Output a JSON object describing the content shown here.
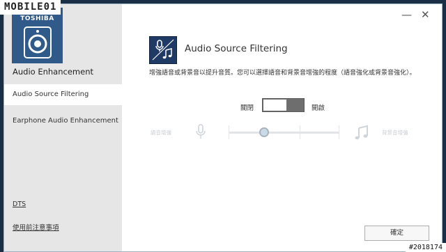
{
  "sidebar": {
    "brand": "TOSHIBA",
    "app_title": "Audio Enhancement",
    "items": [
      {
        "label": "Audio Source Filtering"
      },
      {
        "label": "Earphone Audio Enhancement"
      }
    ],
    "links": {
      "dts": "DTS",
      "notes": "使用前注意事項"
    }
  },
  "titlebar": {
    "minimize": "—",
    "close": "✕"
  },
  "main": {
    "title": "Audio Source Filtering",
    "description": "增強語音或背景音以提升音質。您可以選擇語音和背景音增強的程度（語音強化或背景音強化）。",
    "toggle": {
      "off_label": "關閉",
      "on_label": "開啟",
      "state": "off"
    },
    "slider": {
      "left_label": "語音增強",
      "right_label": "背景音增強",
      "value": 0.3
    },
    "ok_button": "確定"
  },
  "watermark": {
    "top": "MOBILE01",
    "bottom": "#2018174"
  },
  "colors": {
    "sidebar_bg": "#e6e6e6",
    "logo_bg": "#2f5a8a",
    "feature_icon_bg": "#1f3a64",
    "toggle_bg": "#6e6e6e"
  },
  "icons": [
    "speaker-icon",
    "mic-music-icon",
    "microphone-icon",
    "music-note-icon",
    "minimize-icon",
    "close-icon"
  ]
}
